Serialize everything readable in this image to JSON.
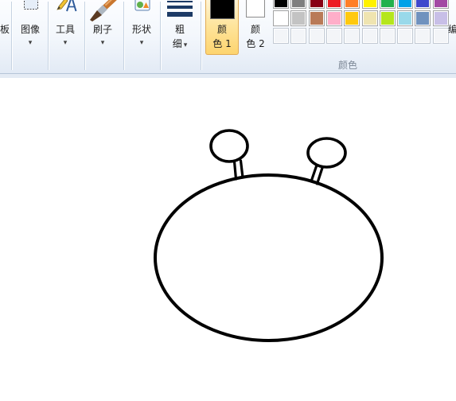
{
  "ribbon": {
    "clipboard": {
      "label": "板"
    },
    "image": {
      "label": "图像",
      "arrow": "▾",
      "icon": "select-icon"
    },
    "tools": {
      "label": "工具",
      "arrow": "▾",
      "icon": "pencil-text-icon"
    },
    "brushes": {
      "label": "刷子",
      "arrow": "▾",
      "icon": "brush-icon"
    },
    "shapes": {
      "label": "形状",
      "arrow": "▾",
      "icon": "shapes-icon"
    },
    "size": {
      "label_1": "粗",
      "label_2": "细",
      "arrow": "▾",
      "icon": "line-width-icon"
    },
    "color1": {
      "label_1": "颜",
      "label_2": "色 1",
      "color": "#000000",
      "selected": true
    },
    "color2": {
      "label_1": "颜",
      "label_2": "色 2",
      "color": "#ffffff"
    },
    "palette": {
      "standard_colors": [
        [
          "#000000",
          "#7f7f7f",
          "#880015",
          "#ed1c24",
          "#ff7f27",
          "#fff200",
          "#22b14c",
          "#00a2e8",
          "#3f48cc",
          "#a349a4"
        ],
        [
          "#ffffff",
          "#c3c3c3",
          "#b97a57",
          "#ffaec9",
          "#ffc90e",
          "#efe4b0",
          "#b5e61d",
          "#99d9ea",
          "#7092be",
          "#c8bfe7"
        ]
      ],
      "custom_colors": [
        null,
        null,
        null,
        null,
        null,
        null,
        null,
        null,
        null,
        null
      ]
    },
    "colors_group_label": "颜色",
    "edit_colors": {
      "label": "编"
    }
  },
  "canvas": {
    "background": "#ffffff",
    "ink": "#000000"
  }
}
